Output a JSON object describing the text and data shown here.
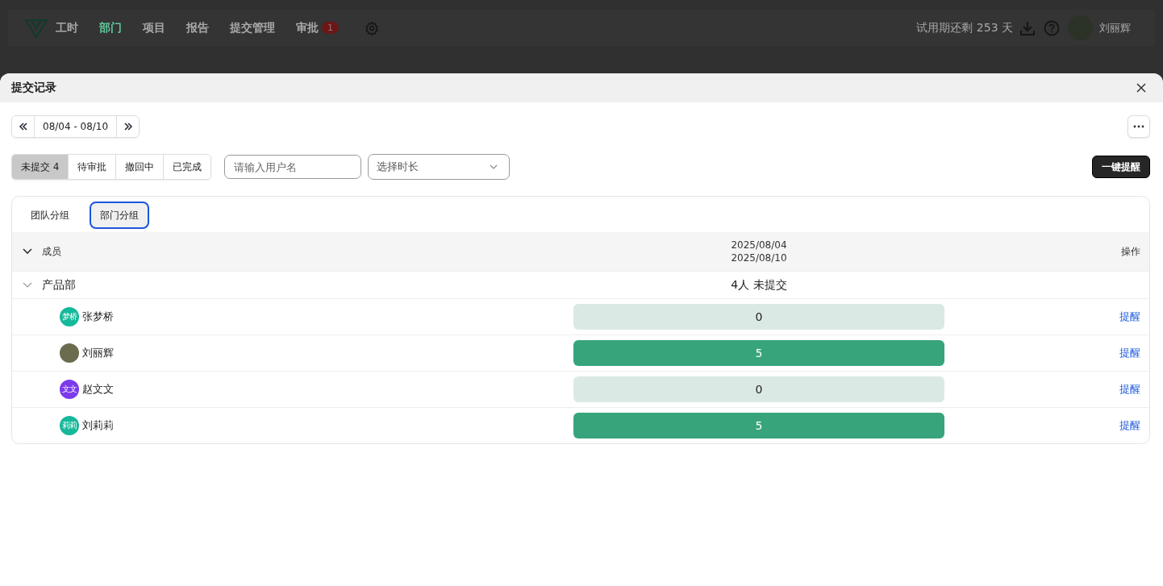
{
  "nav": {
    "items": [
      {
        "label": "工时",
        "selected": false
      },
      {
        "label": "部门",
        "selected": true
      },
      {
        "label": "项目",
        "selected": false
      },
      {
        "label": "报告",
        "selected": false
      },
      {
        "label": "提交管理",
        "selected": false
      },
      {
        "label": "审批",
        "selected": false,
        "badge": "1"
      }
    ],
    "trial": "试用期还剩 253 天",
    "user": "刘丽辉"
  },
  "dialog": {
    "title": "提交记录",
    "date_range": "08/04 - 08/10",
    "status_tabs": [
      {
        "label": "未提交 4",
        "selected": true
      },
      {
        "label": "待审批",
        "selected": false
      },
      {
        "label": "撤回中",
        "selected": false
      },
      {
        "label": "已完成",
        "selected": false
      }
    ],
    "search": {
      "placeholder": "请输入用户名"
    },
    "duration_select": {
      "placeholder": "选择时长"
    },
    "remind_all": "一键提醒",
    "group_tabs": [
      {
        "label": "团队分组",
        "selected": false
      },
      {
        "label": "部门分组",
        "selected": true
      }
    ],
    "table": {
      "columns": [
        "成员",
        [
          "2025/08/04",
          "2025/08/10"
        ],
        "操作"
      ],
      "groups": [
        {
          "name": "产品部",
          "expanded": true,
          "summary": "4人 未提交",
          "members": [
            {
              "name": "张梦桥",
              "avatar": "梦桥",
              "color": "#14b89a",
              "hours": "0",
              "logged": false,
              "action": "提醒"
            },
            {
              "name": "刘丽辉",
              "hours": "5",
              "logged": true,
              "action": "提醒"
            },
            {
              "name": "赵文文",
              "avatar": "文文",
              "color": "#7c3aed",
              "hours": "0",
              "logged": false,
              "action": "提醒"
            },
            {
              "name": "刘莉莉",
              "avatar": "莉莉",
              "color": "#14b89a",
              "hours": "5",
              "logged": true,
              "action": "提醒"
            }
          ]
        }
      ]
    }
  }
}
